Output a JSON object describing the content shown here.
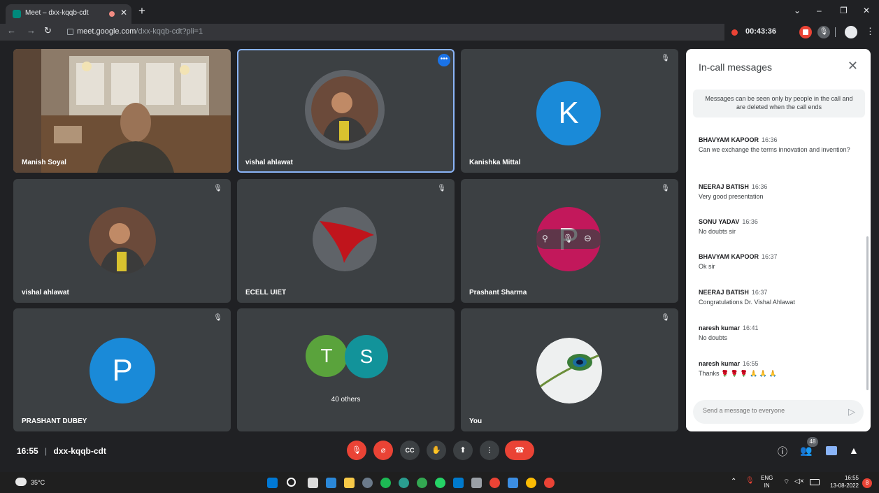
{
  "browser": {
    "tab_title": "Meet – dxx-kqqb-cdt",
    "url_host": "meet.google.com",
    "url_path": "/dxx-kqqb-cdt?pli=1",
    "recording_time": "00:43:36"
  },
  "tiles": [
    {
      "name": "Manish Soyal"
    },
    {
      "name": "vishal ahlawat"
    },
    {
      "name": "Kanishka Mittal",
      "initial": "K"
    },
    {
      "name": "vishal ahlawat"
    },
    {
      "name": "ECELL UIET"
    },
    {
      "name": "Prashant Sharma",
      "initial": "P"
    },
    {
      "name": "PRASHANT DUBEY",
      "initial": "P"
    },
    {
      "name": "40 others",
      "initials": [
        "T",
        "S"
      ]
    },
    {
      "name": "You"
    }
  ],
  "chat": {
    "title": "In-call messages",
    "notice": "Messages can be seen only by people in the call and are deleted when the call ends",
    "messages": [
      {
        "sender": "BHAVYAM KAPOOR",
        "time": "16:36",
        "text": "Can we exchange the terms innovation and invention?"
      },
      {
        "sender": "NEERAJ BATISH",
        "time": "16:36",
        "text": "Very good presentation"
      },
      {
        "sender": "SONU YADAV",
        "time": "16:36",
        "text": "No doubts sir"
      },
      {
        "sender": "BHAVYAM KAPOOR",
        "time": "16:37",
        "text": "Ok sir"
      },
      {
        "sender": "NEERAJ BATISH",
        "time": "16:37",
        "text": "Congratulations Dr. Vishal Ahlawat"
      },
      {
        "sender": "naresh kumar",
        "time": "16:41",
        "text": "No doubts"
      },
      {
        "sender": "naresh kumar",
        "time": "16:55",
        "text": "Thanks 🌹 🌹 🌹 🙏 🙏 🙏"
      }
    ],
    "input_placeholder": "Send a message to everyone"
  },
  "bottom_bar": {
    "meeting_time": "16:55",
    "meeting_code": "dxx-kqqb-cdt",
    "participant_count": "48"
  },
  "taskbar": {
    "weather": "35°C",
    "lang_top": "ENG",
    "lang_bottom": "IN",
    "clock_time": "16:55",
    "clock_date": "13-08-2022",
    "notification_count": "8"
  },
  "colors": {
    "meet_bg": "#202124",
    "tile_bg": "#3c4043",
    "end_call_red": "#ea4335",
    "active_border": "#8ab4f8"
  }
}
